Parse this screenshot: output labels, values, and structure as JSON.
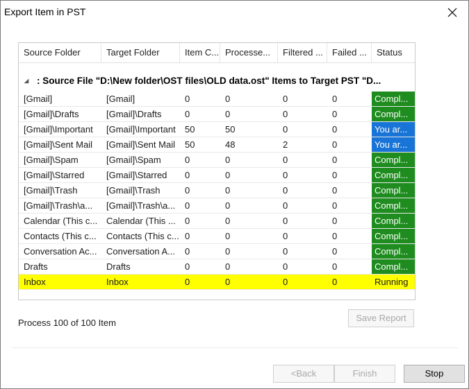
{
  "window": {
    "title": "Export Item in PST"
  },
  "grid": {
    "columns": [
      "Source Folder",
      "Target Folder",
      "Item C...",
      "Processe...",
      "Filtered ...",
      "Failed ...",
      "Status"
    ],
    "group_text": ": Source File \"D:\\New folder\\OST files\\OLD data.ost\" Items to Target PST \"D...",
    "rows": [
      {
        "source": "[Gmail]",
        "target": "[Gmail]",
        "items": "0",
        "processed": "0",
        "filtered": "0",
        "failed": "0",
        "status": "Compl...",
        "status_color": "#1e8c1e"
      },
      {
        "source": "[Gmail]\\Drafts",
        "target": "[Gmail]\\Drafts",
        "items": "0",
        "processed": "0",
        "filtered": "0",
        "failed": "0",
        "status": "Compl...",
        "status_color": "#1e8c1e"
      },
      {
        "source": "[Gmail]\\Important",
        "target": "[Gmail]\\Important",
        "items": "50",
        "processed": "50",
        "filtered": "0",
        "failed": "0",
        "status": "You ar...",
        "status_color": "#1874d6"
      },
      {
        "source": "[Gmail]\\Sent Mail",
        "target": "[Gmail]\\Sent Mail",
        "items": "50",
        "processed": "48",
        "filtered": "2",
        "failed": "0",
        "status": "You ar...",
        "status_color": "#1874d6"
      },
      {
        "source": "[Gmail]\\Spam",
        "target": "[Gmail]\\Spam",
        "items": "0",
        "processed": "0",
        "filtered": "0",
        "failed": "0",
        "status": "Compl...",
        "status_color": "#1e8c1e"
      },
      {
        "source": "[Gmail]\\Starred",
        "target": "[Gmail]\\Starred",
        "items": "0",
        "processed": "0",
        "filtered": "0",
        "failed": "0",
        "status": "Compl...",
        "status_color": "#1e8c1e"
      },
      {
        "source": "[Gmail]\\Trash",
        "target": "[Gmail]\\Trash",
        "items": "0",
        "processed": "0",
        "filtered": "0",
        "failed": "0",
        "status": "Compl...",
        "status_color": "#1e8c1e"
      },
      {
        "source": "[Gmail]\\Trash\\a...",
        "target": "[Gmail]\\Trash\\a...",
        "items": "0",
        "processed": "0",
        "filtered": "0",
        "failed": "0",
        "status": "Compl...",
        "status_color": "#1e8c1e"
      },
      {
        "source": "Calendar (This c...",
        "target": "Calendar (This ...",
        "items": "0",
        "processed": "0",
        "filtered": "0",
        "failed": "0",
        "status": "Compl...",
        "status_color": "#1e8c1e"
      },
      {
        "source": "Contacts (This c...",
        "target": "Contacts (This c...",
        "items": "0",
        "processed": "0",
        "filtered": "0",
        "failed": "0",
        "status": "Compl...",
        "status_color": "#1e8c1e"
      },
      {
        "source": "Conversation Ac...",
        "target": "Conversation A...",
        "items": "0",
        "processed": "0",
        "filtered": "0",
        "failed": "0",
        "status": "Compl...",
        "status_color": "#1e8c1e"
      },
      {
        "source": "Drafts",
        "target": "Drafts",
        "items": "0",
        "processed": "0",
        "filtered": "0",
        "failed": "0",
        "status": "Compl...",
        "status_color": "#1e8c1e"
      },
      {
        "source": "Inbox",
        "target": "Inbox",
        "items": "0",
        "processed": "0",
        "filtered": "0",
        "failed": "0",
        "status": "Running",
        "status_color": "",
        "highlight": "#ffff00"
      }
    ]
  },
  "progress_text": "Process 100 of 100 Item",
  "buttons": {
    "save_report": "Save Report",
    "back": "<Back",
    "finish": "Finish",
    "stop": "Stop"
  }
}
